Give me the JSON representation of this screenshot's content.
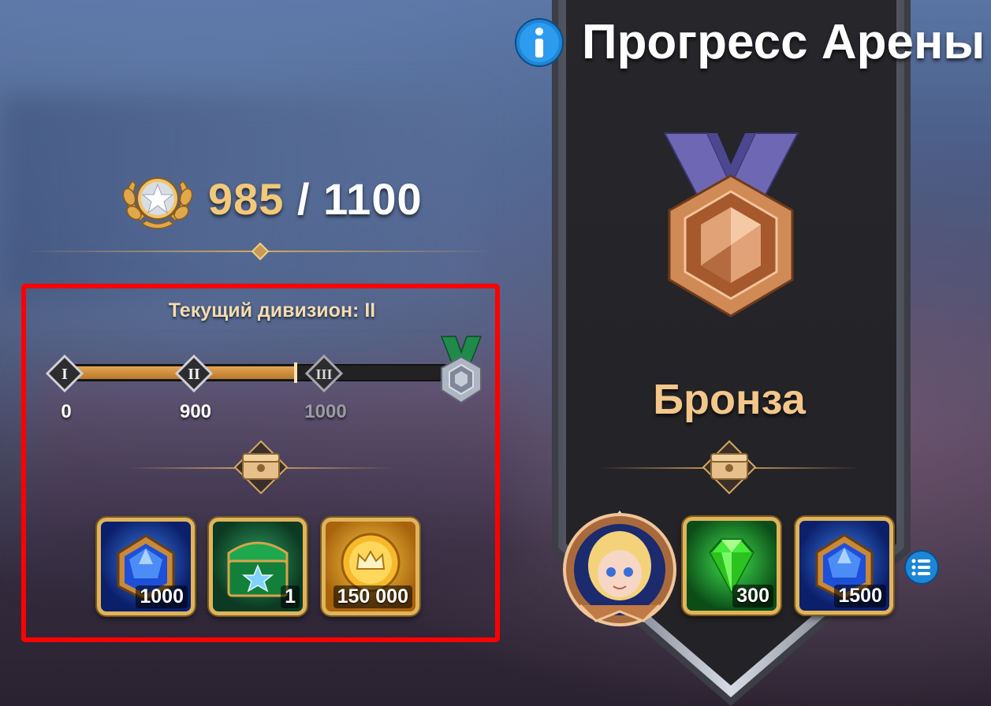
{
  "rating": {
    "current": "985",
    "separator": " / ",
    "max": "1100"
  },
  "division": {
    "title": "Текущий дивизион: II",
    "progress_fraction": 0.59,
    "nodes": [
      {
        "roman": "I",
        "label": "0",
        "reached": true
      },
      {
        "roman": "II",
        "label": "900",
        "reached": true
      },
      {
        "roman": "III",
        "label": "1000",
        "reached": false
      }
    ]
  },
  "division_rewards": [
    {
      "icon": "blue-gem-emblem-icon",
      "amount": "1000"
    },
    {
      "icon": "green-chest-icon",
      "amount": "1"
    },
    {
      "icon": "gold-coin-icon",
      "amount": "150 000"
    }
  ],
  "arena": {
    "title": "Прогресс Арены",
    "tier": "Бронза",
    "tier_rewards": [
      {
        "icon": "hero-portrait-icon",
        "amount": ""
      },
      {
        "icon": "green-emerald-icon",
        "amount": "300"
      },
      {
        "icon": "blue-gem-emblem-icon",
        "amount": "1500"
      }
    ]
  },
  "colors": {
    "accent_gold": "#e0b45c",
    "highlight_red": "#ff0000",
    "tier_text": "#f3c68a",
    "rating_current": "#f2c879"
  }
}
